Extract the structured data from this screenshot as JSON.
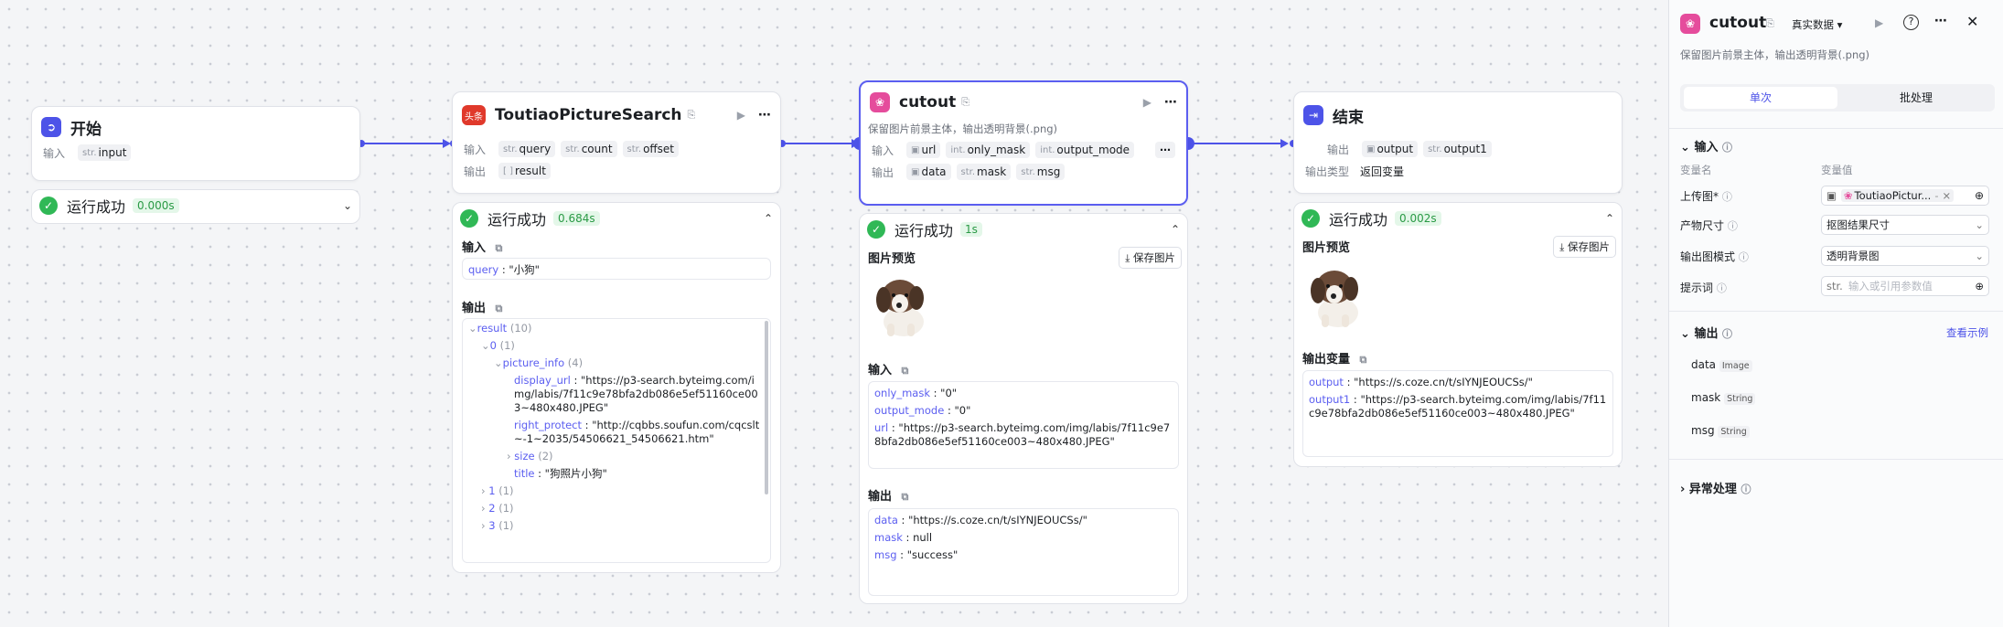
{
  "start": {
    "title": "开始",
    "input_label": "输入",
    "input_type": "str.",
    "input_name": "input",
    "status": "运行成功",
    "time": "0.000s"
  },
  "toutiao": {
    "title": "ToutiaoPictureSearch",
    "in_label": "输入",
    "out_label": "输出",
    "inputs": [
      {
        "type": "str.",
        "name": "query"
      },
      {
        "type": "str.",
        "name": "count"
      },
      {
        "type": "str.",
        "name": "offset"
      }
    ],
    "outputs": [
      {
        "type": "[ ]",
        "name": "result"
      }
    ],
    "status": "运行成功",
    "time": "0.684s",
    "input_title": "输入",
    "input_key": "query",
    "input_val": "\"小狗\"",
    "output_title": "输出",
    "tree": {
      "result": "result",
      "result_count": "(10)",
      "i0": "0",
      "i0c": "(1)",
      "pi": "picture_info",
      "pic": "(4)",
      "du_k": "display_url",
      "du_v": "\"https://p3-search.byteimg.com/img/labis/7f11c9e78bfa2db086e5ef51160ce003~480x480.JPEG\"",
      "rp_k": "right_protect",
      "rp_v": "\"http://cqbbs.soufun.com/cqcslt~-1~2035/54506621_54506621.htm\"",
      "size": "size",
      "sizec": "(2)",
      "title_k": "title",
      "title_v": "\"狗照片小狗\"",
      "i1": "1",
      "i1c": "(1)",
      "i2": "2",
      "i2c": "(1)",
      "i3": "3",
      "i3c": "(1)"
    }
  },
  "cutout": {
    "title": "cutout",
    "desc": "保留图片前景主体，输出透明背景(.png)",
    "in_label": "输入",
    "out_label": "输出",
    "inputs": [
      {
        "type": "img",
        "name": "url"
      },
      {
        "type": "int.",
        "name": "only_mask"
      },
      {
        "type": "int.",
        "name": "output_mode"
      }
    ],
    "outputs": [
      {
        "type": "img",
        "name": "data"
      },
      {
        "type": "str.",
        "name": "mask"
      },
      {
        "type": "str.",
        "name": "msg"
      }
    ],
    "status": "运行成功",
    "time": "1s",
    "preview": "图片预览",
    "save": "保存图片",
    "input_title": "输入",
    "input_kv": [
      {
        "k": "only_mask",
        "v": "\"0\""
      },
      {
        "k": "output_mode",
        "v": "\"0\""
      },
      {
        "k": "url",
        "v": "\"https://p3-search.byteimg.com/img/labis/7f11c9e78bfa2db086e5ef51160ce003~480x480.JPEG\""
      }
    ],
    "output_title": "输出",
    "output_kv": [
      {
        "k": "data",
        "v": "\"https://s.coze.cn/t/sIYNJEOUCSs/\""
      },
      {
        "k": "mask",
        "v": "null"
      },
      {
        "k": "msg",
        "v": "\"success\""
      }
    ]
  },
  "end": {
    "title": "结束",
    "out_label": "输出",
    "outputs": [
      {
        "type": "img",
        "name": "output"
      },
      {
        "type": "str.",
        "name": "output1"
      }
    ],
    "type_label": "输出类型",
    "type_value": "返回变量",
    "status": "运行成功",
    "time": "0.002s",
    "preview": "图片预览",
    "save": "保存图片",
    "var_title": "输出变量",
    "vars": [
      {
        "k": "output",
        "v": "\"https://s.coze.cn/t/sIYNJEOUCSs/\""
      },
      {
        "k": "output1",
        "v": "\"https://p3-search.byteimg.com/img/labis/7f11c9e78bfa2db086e5ef51160ce003~480x480.JPEG\""
      }
    ]
  },
  "side": {
    "title": "cutout",
    "mode": "真实数据",
    "desc": "保留图片前景主体，输出透明背景(.png)",
    "tab_single": "单次",
    "tab_batch": "批处理",
    "input_section": "输入",
    "col_name": "变量名",
    "col_value": "变量值",
    "params": [
      {
        "name": "上传图*",
        "value": "ToutiaoPictur...",
        "extra": "-"
      },
      {
        "name": "产物尺寸",
        "value": "抠图结果尺寸"
      },
      {
        "name": "输出图模式",
        "value": "透明背景图"
      },
      {
        "name": "提示词",
        "value": "",
        "placeholder": "输入或引用参数值",
        "type": "str."
      }
    ],
    "output_section": "输出",
    "see_example": "查看示例",
    "outputs": [
      {
        "name": "data",
        "type": "Image"
      },
      {
        "name": "mask",
        "type": "String"
      },
      {
        "name": "msg",
        "type": "String"
      }
    ],
    "error_section": "异常处理"
  },
  "colors": {
    "accent": "#4d53e8",
    "success": "#30b856"
  }
}
